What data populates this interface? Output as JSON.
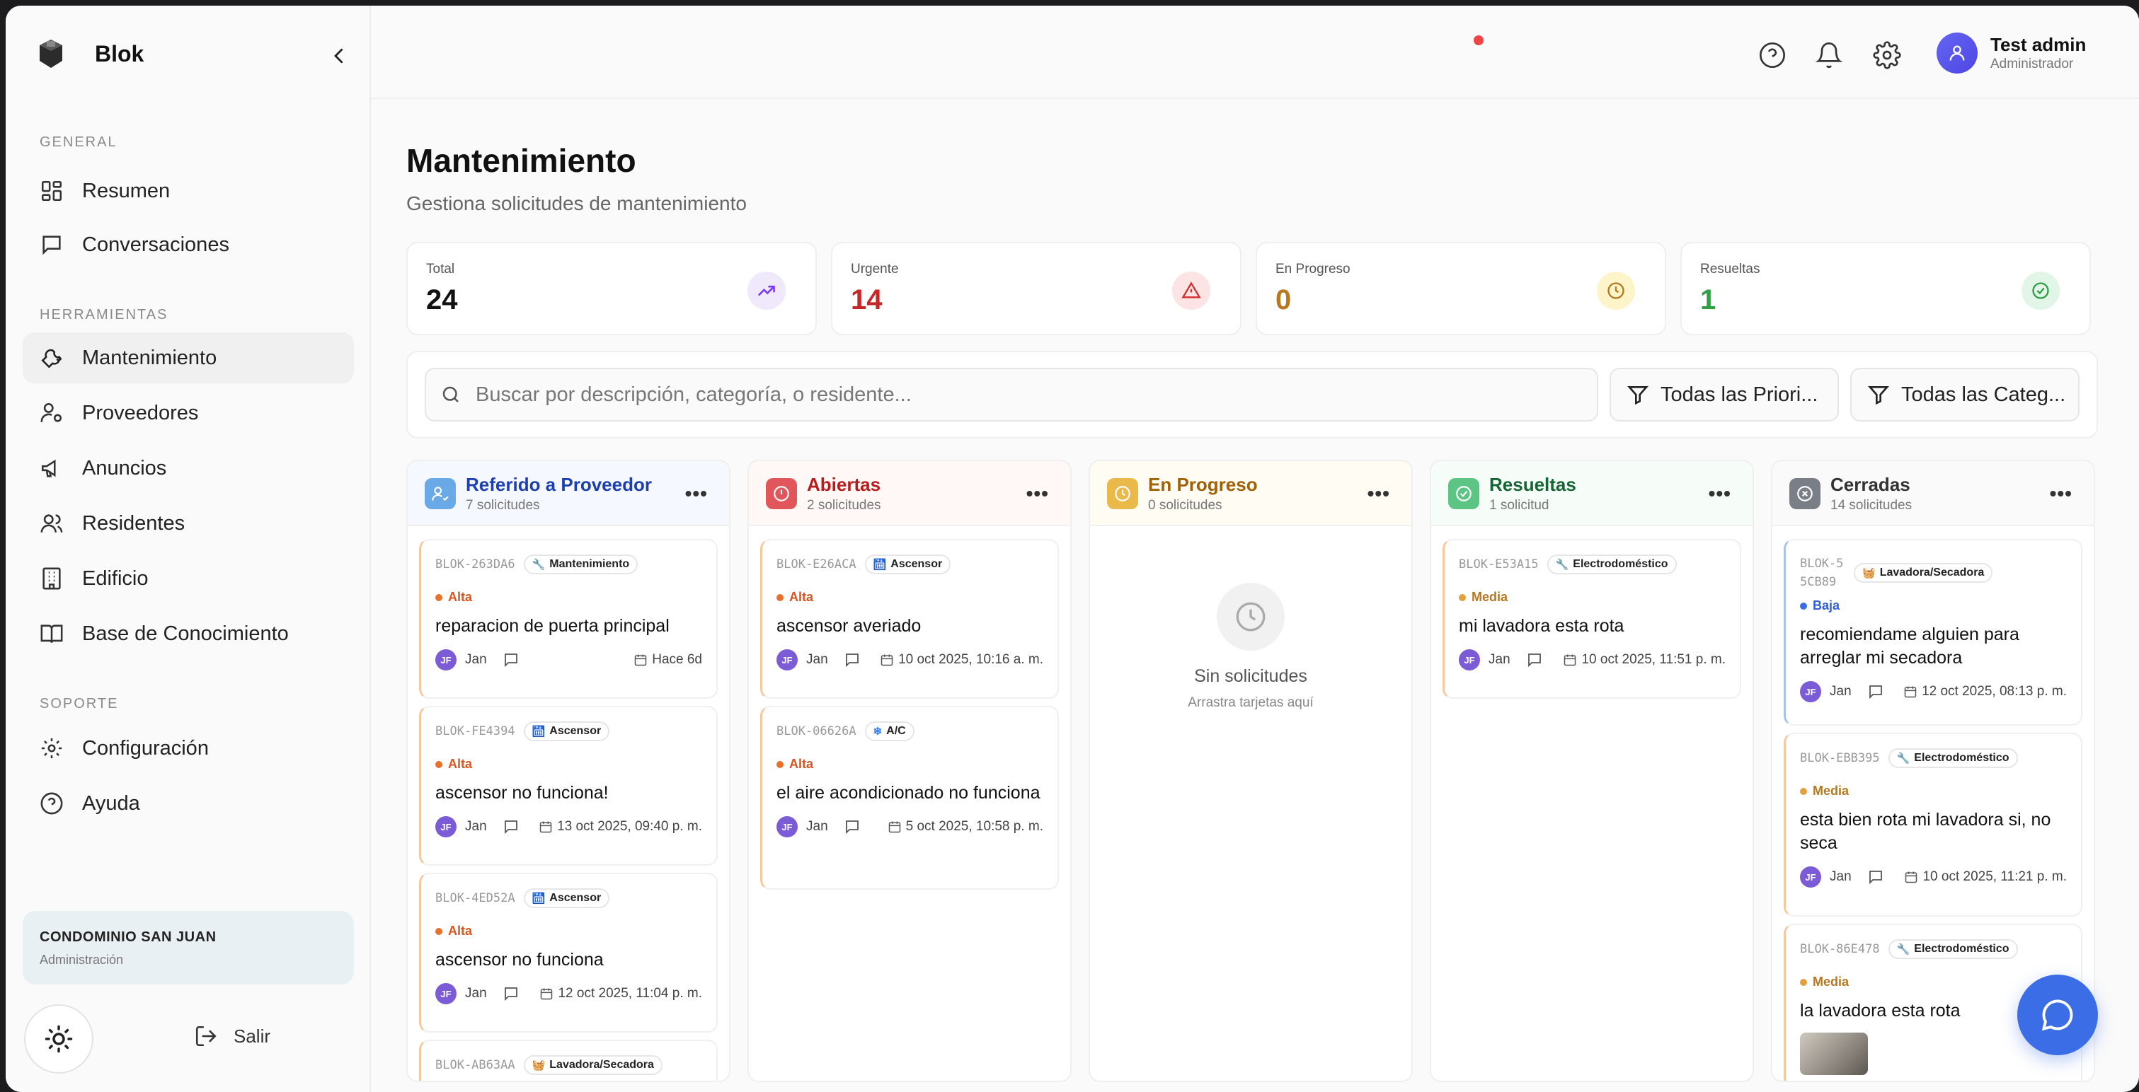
{
  "app": {
    "name": "Blok"
  },
  "sidebar": {
    "sections": {
      "general": "GENERAL",
      "tools": "HERRAMIENTAS",
      "support": "SOPORTE"
    },
    "items": [
      {
        "label": "Resumen",
        "icon": "dashboard-icon"
      },
      {
        "label": "Conversaciones",
        "icon": "chat-icon"
      },
      {
        "label": "Mantenimiento",
        "icon": "wrench-icon",
        "active": true
      },
      {
        "label": "Proveedores",
        "icon": "user-cog-icon"
      },
      {
        "label": "Anuncios",
        "icon": "megaphone-icon"
      },
      {
        "label": "Residentes",
        "icon": "users-icon"
      },
      {
        "label": "Edificio",
        "icon": "building-icon"
      },
      {
        "label": "Base de Conocimiento",
        "icon": "book-icon"
      },
      {
        "label": "Configuración",
        "icon": "gear-icon"
      },
      {
        "label": "Ayuda",
        "icon": "help-icon"
      }
    ],
    "condo": {
      "title": "CONDOMINIO SAN JUAN",
      "subtitle": "Administración"
    },
    "logout": "Salir"
  },
  "user": {
    "name": "Test admin",
    "role": "Administrador"
  },
  "page": {
    "title": "Mantenimiento",
    "subtitle": "Gestiona solicitudes de mantenimiento"
  },
  "stats": [
    {
      "label": "Total",
      "value": "24",
      "color": "#111111"
    },
    {
      "label": "Urgente",
      "value": "14",
      "color": "#c62828"
    },
    {
      "label": "En Progreso",
      "value": "0",
      "color": "#b7791f"
    },
    {
      "label": "Resueltas",
      "value": "1",
      "color": "#2f9e44"
    }
  ],
  "filters": {
    "search_placeholder": "Buscar por descripción, categoría, o residente...",
    "priority": "Todas las Priori...",
    "category": "Todas las Categ..."
  },
  "columns": [
    {
      "title": "Referido a Proveedor",
      "count": "7 solicitudes",
      "color": "#1e40af",
      "bg": "#f5f8ff",
      "cards": [
        {
          "code": "BLOK-263DA6",
          "tag": "Mantenimiento",
          "tag_icon": "🔧",
          "priority": "Alta",
          "desc": "reparacion de puerta principal",
          "initials": "JF",
          "user": "Jan",
          "date": "Hace 6d"
        },
        {
          "code": "BLOK-FE4394",
          "tag": "Ascensor",
          "tag_icon": "🛗",
          "priority": "Alta",
          "desc": "ascensor no funciona!",
          "initials": "JF",
          "user": "Jan",
          "date": "13 oct 2025, 09:40 p. m."
        },
        {
          "code": "BLOK-4ED52A",
          "tag": "Ascensor",
          "tag_icon": "🛗",
          "priority": "Alta",
          "desc": "ascensor no funciona",
          "initials": "JF",
          "user": "Jan",
          "date": "12 oct 2025, 11:04 p. m."
        },
        {
          "code": "BLOK-AB63AA",
          "tag": "Lavadora/Secadora",
          "tag_icon": "🧺"
        }
      ]
    },
    {
      "title": "Abiertas",
      "count": "2 solicitudes",
      "color": "#b91c1c",
      "bg": "#fff8f7",
      "cards": [
        {
          "code": "BLOK-E26ACA",
          "tag": "Ascensor",
          "tag_icon": "🛗",
          "priority": "Alta",
          "desc": "ascensor averiado",
          "initials": "JF",
          "user": "Jan",
          "date": "10 oct 2025, 10:16 a. m."
        },
        {
          "code": "BLOK-06626A",
          "tag": "A/C",
          "tag_icon": "❄",
          "priority": "Alta",
          "desc": "el aire acondicionado no funciona",
          "initials": "JF",
          "user": "Jan",
          "date": "5 oct 2025, 10:58 p. m."
        }
      ]
    },
    {
      "title": "En Progreso",
      "count": "0 solicitudes",
      "color": "#a16207",
      "bg": "#fffcf3",
      "empty": {
        "title": "Sin solicitudes",
        "subtitle": "Arrastra tarjetas aquí"
      }
    },
    {
      "title": "Resueltas",
      "count": "1 solicitud",
      "color": "#166534",
      "bg": "#f6fdf8",
      "cards": [
        {
          "code": "BLOK-E53A15",
          "tag": "Electrodoméstico",
          "tag_icon": "🔧",
          "priority": "Media",
          "desc": "mi lavadora esta rota",
          "initials": "JF",
          "user": "Jan",
          "date": "10 oct 2025, 11:51 p. m."
        }
      ]
    },
    {
      "title": "Cerradas",
      "count": "14 solicitudes",
      "color": "#333333",
      "bg": "#fafafa",
      "cards": [
        {
          "code": "BLOK-55CB89",
          "tag": "Lavadora/Secadora",
          "tag_icon": "🧺",
          "priority": "Baja",
          "desc": "recomiendame alguien para arreglar mi secadora",
          "initials": "JF",
          "user": "Jan",
          "date": "12 oct 2025, 08:13 p. m."
        },
        {
          "code": "BLOK-EBB395",
          "tag": "Electrodoméstico",
          "tag_icon": "🔧",
          "priority": "Media",
          "desc": "esta bien rota mi lavadora si, no seca",
          "initials": "JF",
          "user": "Jan",
          "date": "10 oct 2025, 11:21 p. m."
        },
        {
          "code": "BLOK-86E478",
          "tag": "Electrodoméstico",
          "tag_icon": "🔧",
          "priority": "Media",
          "desc": "la lavadora esta rota"
        }
      ]
    }
  ],
  "colors": {
    "alta": "#e8702a",
    "media": "#e2a03f",
    "baja": "#3b6de6",
    "fab": "#3b6de6"
  }
}
